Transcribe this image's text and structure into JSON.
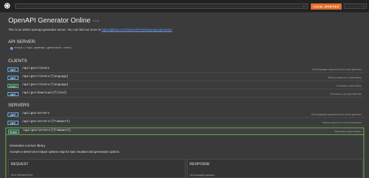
{
  "topbar": {
    "search_placeholder": "",
    "local_json_label": "LOCAL JSON FILE"
  },
  "page": {
    "title": "OpenAPI Generator Online",
    "version": "7.7.0",
    "intro_prefix": "This is an online openapi generator server. You can find out more at ",
    "intro_link": "https://github.com/OpenAPITools/openapi-generator"
  },
  "api_server": {
    "heading": "API SERVER:",
    "url": "https://api.openapi-generator.tech/"
  },
  "clients": {
    "heading": "CLIENTS",
    "ops": [
      {
        "method": "GET",
        "path": "/api/gen/clients",
        "desc": "Gets languages supported by the client generator"
      },
      {
        "method": "GET",
        "path": "/api/gen/clients/{language}",
        "desc": "Returns options for a client library"
      },
      {
        "method": "POST",
        "path": "/api/gen/clients/{language}",
        "desc": "Generates a client library"
      },
      {
        "method": "GET",
        "path": "/api/gen/download/{fileId}",
        "desc": "Downloads a pre-generated file"
      }
    ]
  },
  "servers": {
    "heading": "SERVERS",
    "ops": [
      {
        "method": "GET",
        "path": "/api/gen/servers",
        "desc": "Gets languages supported by the server generator"
      },
      {
        "method": "GET",
        "path": "/api/gen/servers/{framework}",
        "desc": "Returns options for a server framework"
      },
      {
        "method": "POST",
        "path": "/api/gen/servers/{framework}",
        "desc": "Generates a server library"
      }
    ]
  },
  "expanded": {
    "summary": "Generates a server library",
    "desc_prefix": "Accepts a ",
    "desc_code": "GeneratorInput",
    "desc_suffix": " options map for spec location and generation options.",
    "request_label": "REQUEST",
    "response_label": "RESPONSE",
    "path_params_label": "PATH PARAMETERS",
    "response_sub": "200  successful operation"
  }
}
